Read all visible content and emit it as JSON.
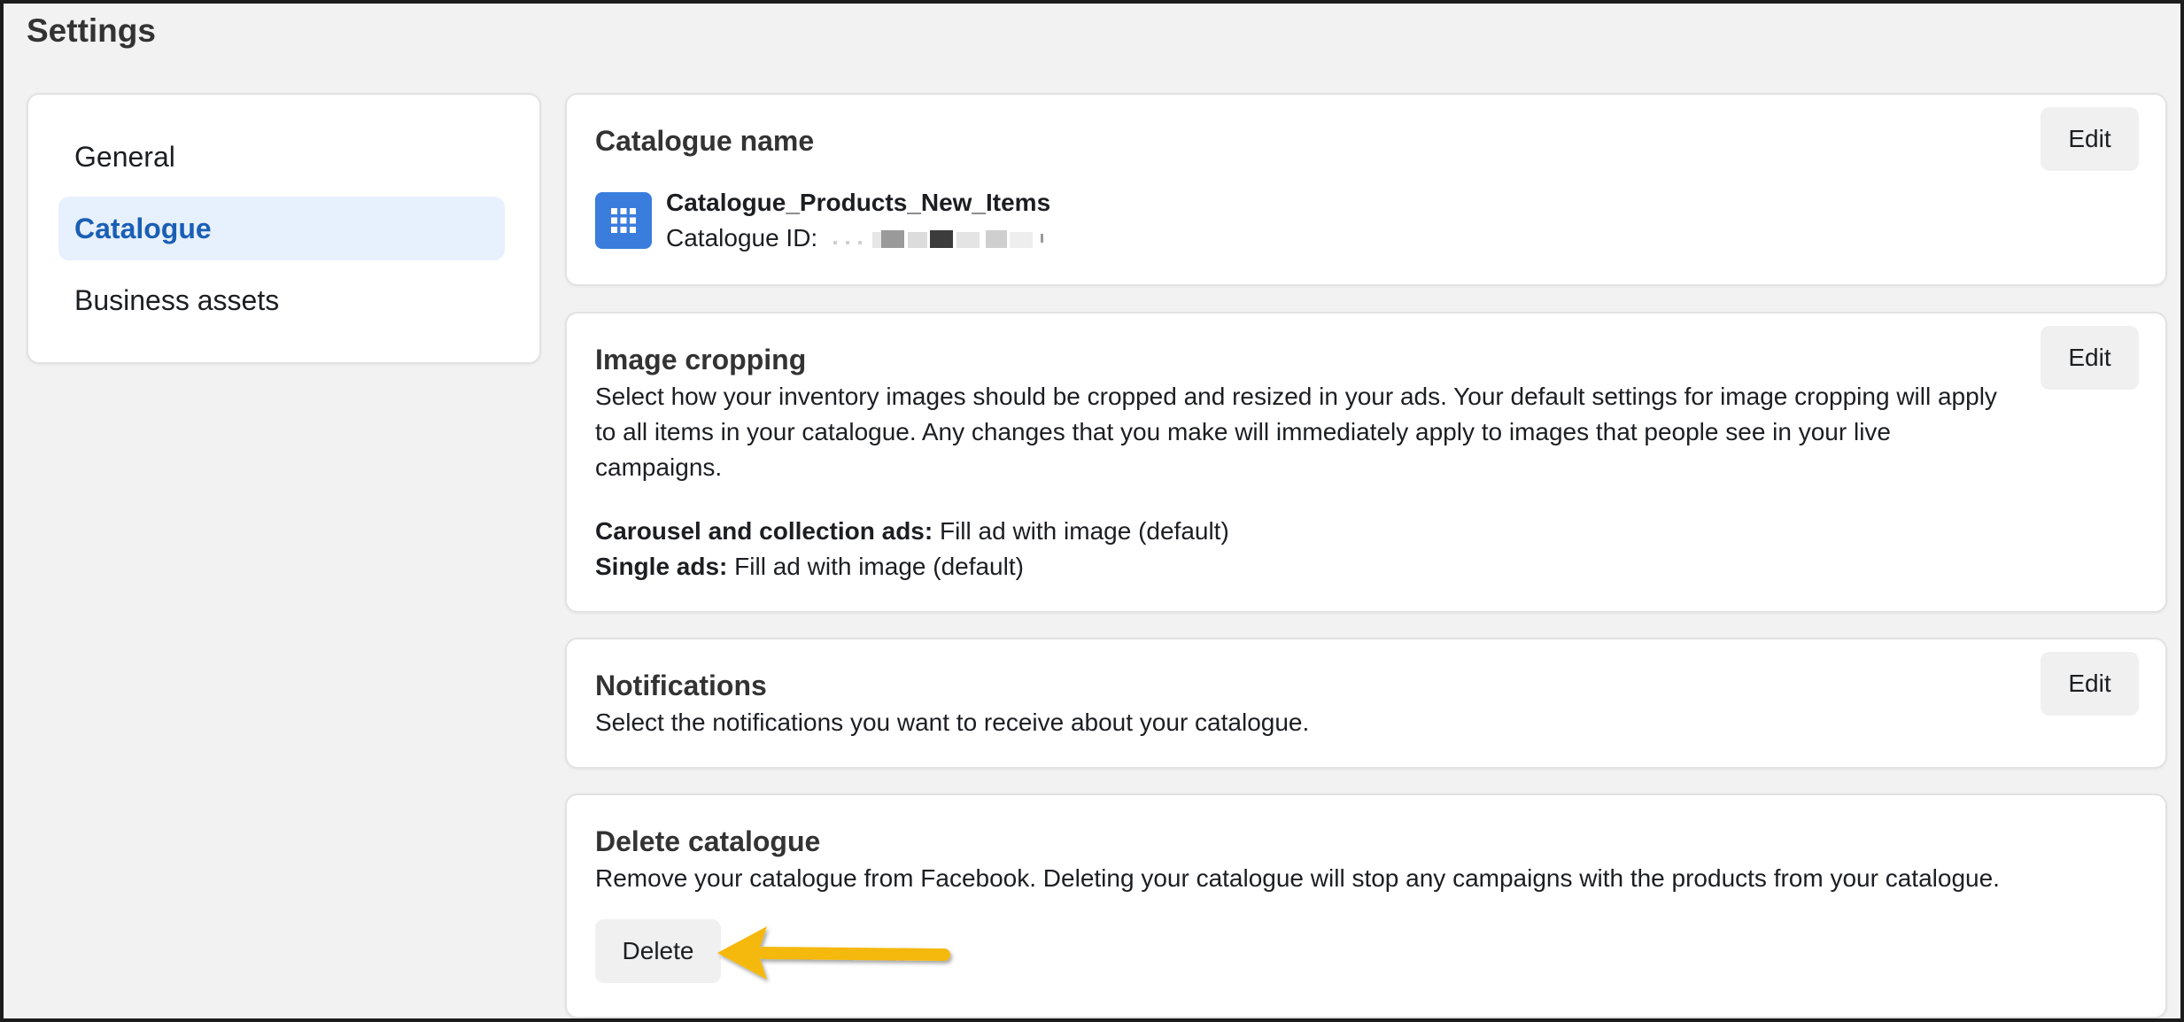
{
  "header": {
    "title": "Settings"
  },
  "sidebar": {
    "items": [
      {
        "label": "General"
      },
      {
        "label": "Catalogue"
      },
      {
        "label": "Business assets"
      }
    ],
    "active_index": 1
  },
  "catalogue_name": {
    "title": "Catalogue name",
    "edit_label": "Edit",
    "name": "Catalogue_Products_New_Items",
    "id_label": "Catalogue ID:",
    "icon": "grid-icon"
  },
  "image_cropping": {
    "title": "Image cropping",
    "edit_label": "Edit",
    "description": "Select how your inventory images should be cropped and resized in your ads. Your default settings for image cropping will apply to all items in your catalogue. Any changes that you make will immediately apply to images that people see in your live campaigns.",
    "carousel_label": "Carousel and collection ads:",
    "carousel_value": "Fill ad with image (default)",
    "single_label": "Single ads:",
    "single_value": "Fill ad with image (default)"
  },
  "notifications": {
    "title": "Notifications",
    "edit_label": "Edit",
    "description": "Select the notifications you want to receive about your catalogue."
  },
  "delete_catalogue": {
    "title": "Delete catalogue",
    "description": "Remove your catalogue from Facebook. Deleting your catalogue will stop any campaigns with the products from your catalogue.",
    "button_label": "Delete"
  },
  "colors": {
    "accent": "#1a5fb4",
    "active_bg": "#e7f0fd",
    "icon_bg": "#3b7ddd",
    "arrow": "#f5b80a",
    "page_bg": "#f2f2f2"
  }
}
